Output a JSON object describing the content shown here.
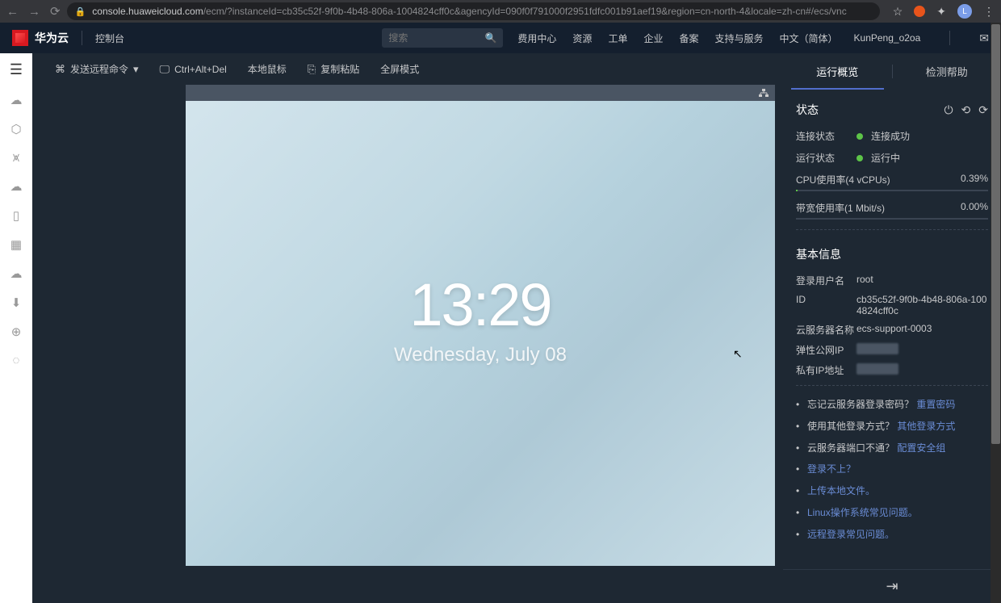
{
  "browser": {
    "url_host": "console.huaweicloud.com",
    "url_path": "/ecm/?instanceId=cb35c52f-9f0b-4b48-806a-1004824cff0c&agencyId=090f0f791000f2951fdfc001b91aef19&region=cn-north-4&locale=zh-cn#/ecs/vnc",
    "avatar_letter": "L"
  },
  "topnav": {
    "brand": "华为云",
    "console": "控制台",
    "search_placeholder": "搜索",
    "menu": [
      "费用中心",
      "资源",
      "工单",
      "企业",
      "备案",
      "支持与服务",
      "中文（简体）"
    ],
    "user": "KunPeng_o2oa"
  },
  "toolbar": {
    "send_cmd": "发送远程命令",
    "ctrlaltdel": "Ctrl+Alt+Del",
    "local_mouse": "本地鼠标",
    "copy_paste": "复制粘贴",
    "fullscreen": "全屏模式"
  },
  "vnc": {
    "time": "13:29",
    "date": "Wednesday, July 08"
  },
  "sidebar": {
    "tabs": {
      "overview": "运行概览",
      "help": "检测帮助"
    },
    "status_section": "状态",
    "conn_label": "连接状态",
    "conn_val": "连接成功",
    "run_label": "运行状态",
    "run_val": "运行中",
    "cpu_label": "CPU使用率(4 vCPUs)",
    "cpu_val": "0.39%",
    "bw_label": "带宽使用率(1 Mbit/s)",
    "bw_val": "0.00%",
    "info_section": "基本信息",
    "info": {
      "user_label": "登录用户名",
      "user_val": "root",
      "id_label": "ID",
      "id_val": "cb35c52f-9f0b-4b48-806a-1004824cff0c",
      "name_label": "云服务器名称",
      "name_val": "ecs-support-0003",
      "eip_label": "弹性公网IP",
      "pip_label": "私有IP地址"
    },
    "help": {
      "q1": "忘记云服务器登录密码？",
      "a1": "重置密码",
      "q2": "使用其他登录方式？",
      "a2": "其他登录方式",
      "q3": "云服务器端口不通？",
      "a3": "配置安全组",
      "l4": "登录不上？",
      "l5": "上传本地文件。",
      "l6": "Linux操作系统常见问题。",
      "l7": "远程登录常见问题。"
    }
  }
}
